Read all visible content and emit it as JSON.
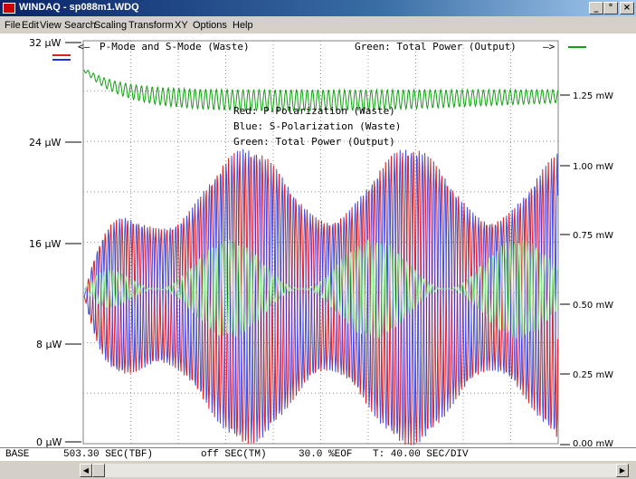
{
  "window": {
    "title": "WINDAQ - sp088m1.WDQ",
    "minimize": "_",
    "restore": "°",
    "close": "×"
  },
  "menu": [
    "File",
    "Edit",
    "View",
    "Search",
    "Scaling",
    "Transform",
    "XY",
    "Options",
    "Help"
  ],
  "plot": {
    "left_axis_ticks": [
      "32 µW",
      "24 µW",
      "16 µW",
      "8 µW",
      "0 µW"
    ],
    "right_axis_ticks": [
      "1.25 mW",
      "1.00 mW",
      "0.75 mW",
      "0.50 mW",
      "0.25 mW",
      "0.00 mW"
    ],
    "top_left_label": "P-Mode and S-Mode (Waste)",
    "top_right_label": "Green: Total Power (Output)",
    "legend": [
      "Red: P-Polarization (Waste)",
      "Blue: S-Polarization (Waste)",
      "Green: Total Power (Output)"
    ],
    "colors": {
      "red": "#e02020",
      "blue": "#2030e0",
      "green": "#10a010",
      "grid": "#808080"
    }
  },
  "status": {
    "channel": "BASE",
    "time": "503.30 SEC(TBF)",
    "marker": "off SEC(TM)",
    "eof": "30.0 %EOF",
    "div": "T: 40.00 SEC/DIV"
  }
}
